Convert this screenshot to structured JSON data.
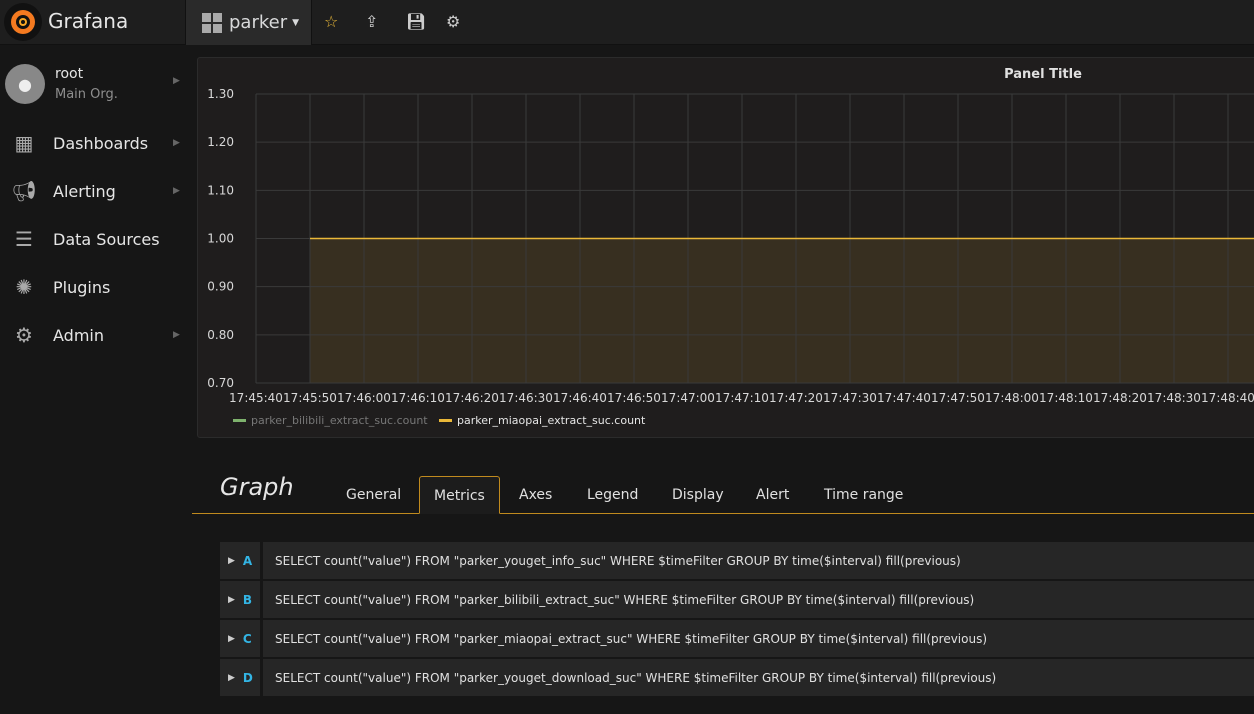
{
  "app": {
    "brand": "Grafana",
    "dashboard": "parker"
  },
  "user": {
    "name": "root",
    "org": "Main Org."
  },
  "sidebar": {
    "items": [
      {
        "label": "Dashboards",
        "icon": "dashboards-icon",
        "arrow": true
      },
      {
        "label": "Alerting",
        "icon": "bullhorn-icon",
        "arrow": true
      },
      {
        "label": "Data Sources",
        "icon": "database-icon",
        "arrow": false
      },
      {
        "label": "Plugins",
        "icon": "plugins-icon",
        "arrow": false
      },
      {
        "label": "Admin",
        "icon": "cogs-icon",
        "arrow": true
      }
    ]
  },
  "panel": {
    "title": "Panel Title"
  },
  "editor": {
    "title": "Graph",
    "tabs": [
      "General",
      "Metrics",
      "Axes",
      "Legend",
      "Display",
      "Alert",
      "Time range"
    ],
    "active_tab": "Metrics",
    "queries": [
      {
        "ref": "A",
        "query": "SELECT count(\"value\") FROM \"parker_youget_info_suc\" WHERE $timeFilter GROUP BY time($interval) fill(previous)"
      },
      {
        "ref": "B",
        "query": "SELECT count(\"value\") FROM \"parker_bilibili_extract_suc\" WHERE $timeFilter GROUP BY time($interval) fill(previous)"
      },
      {
        "ref": "C",
        "query": "SELECT count(\"value\") FROM \"parker_miaopai_extract_suc\" WHERE $timeFilter GROUP BY time($interval) fill(previous)"
      },
      {
        "ref": "D",
        "query": "SELECT count(\"value\") FROM \"parker_youget_download_suc\" WHERE $timeFilter GROUP BY time($interval) fill(previous)"
      }
    ]
  },
  "chart_data": {
    "type": "area",
    "title": "Panel Title",
    "ylim": [
      0.7,
      1.3
    ],
    "yticks": [
      "1.30",
      "1.20",
      "1.10",
      "1.00",
      "0.90",
      "0.80",
      "0.70"
    ],
    "xticks": [
      "17:45:40",
      "17:45:50",
      "17:46:00",
      "17:46:10",
      "17:46:20",
      "17:46:30",
      "17:46:40",
      "17:46:50",
      "17:47:00",
      "17:47:10",
      "17:47:20",
      "17:47:30",
      "17:47:40",
      "17:47:50",
      "17:48:00",
      "17:48:10",
      "17:48:20",
      "17:48:30",
      "17:48:40"
    ],
    "xlim": [
      "17:45:40",
      "17:48:45"
    ],
    "grid": true,
    "legend_position": "bottom",
    "series": [
      {
        "name": "parker_bilibili_extract_suc.count",
        "color": "#7eb26d",
        "hidden": true,
        "points": []
      },
      {
        "name": "parker_miaopai_extract_suc.count",
        "color": "#eab839",
        "hidden": false,
        "points": [
          [
            "17:45:50",
            1.0
          ],
          [
            "17:48:45",
            1.0
          ]
        ]
      }
    ]
  }
}
